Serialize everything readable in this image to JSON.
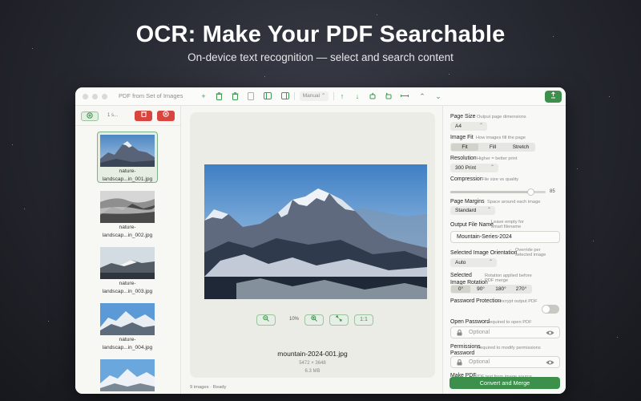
{
  "hero": {
    "title": "OCR: Make Your PDF Searchable",
    "subtitle": "On-device text recognition — select and search content"
  },
  "window": {
    "title": "PDF from Set of Images",
    "toolbar": {
      "mode_select": "Manual",
      "icons": [
        "add-icon",
        "trash-icon",
        "trash-icon",
        "document-icon",
        "sidebar-left-icon",
        "sidebar-right-icon",
        "arrow-up-icon",
        "arrow-down-icon",
        "rotate-left-icon",
        "rotate-right-icon",
        "dash-icon",
        "chevron-up-icon",
        "chevron-down-icon",
        "export-icon"
      ]
    }
  },
  "sidebar": {
    "count": "1 s...",
    "items": [
      {
        "label_line1": "nature-",
        "label_line2": "landscap...in_001.jpg",
        "selected": true
      },
      {
        "label_line1": "nature-",
        "label_line2": "landscap...in_002.jpg",
        "selected": false
      },
      {
        "label_line1": "nature-",
        "label_line2": "landscap...in_003.jpg",
        "selected": false
      },
      {
        "label_line1": "nature-",
        "label_line2": "landscap...in_004.jpg",
        "selected": false
      },
      {
        "label_line1": "",
        "label_line2": "",
        "selected": false
      }
    ],
    "status": "9 images · Ready"
  },
  "canvas": {
    "zoom": "10%",
    "fit_label": "1:1",
    "file_name": "mountain-2024-001.jpg",
    "dimensions": "5472 × 3648",
    "size": "6.3 MB"
  },
  "settings": {
    "page_size": {
      "label": "Page Size",
      "hint": "Output page dimensions",
      "value": "A4"
    },
    "image_fit": {
      "label": "Image Fit",
      "hint": "How images fill the page",
      "options": [
        "Fit",
        "Fill",
        "Stretch"
      ],
      "selected": "Fit"
    },
    "resolution": {
      "label": "Resolution",
      "hint": "Higher = better print",
      "value": "300 Print"
    },
    "compression": {
      "label": "Compression",
      "hint": "File size vs quality",
      "value": 85,
      "display": "85"
    },
    "page_margins": {
      "label": "Page Margins",
      "hint": "Space around each image",
      "value": "Standard"
    },
    "output_name": {
      "label": "Output File Name",
      "hint_line1": "Leave empty for",
      "hint_line2": "smart filename",
      "value": "Mountain-Series-2024"
    },
    "orientation": {
      "label": "Selected Image Orientation",
      "hint_line1": "Override per",
      "hint_line2": "selected image",
      "value": "Auto"
    },
    "rotation": {
      "label_line1": "Selected",
      "label_line2": "Image Rotation",
      "hint_line1": "Rotation applied before",
      "hint_line2": "PDF merge",
      "options": [
        "0°",
        "90°",
        "180°",
        "270°"
      ],
      "selected": "0°"
    },
    "password_protection": {
      "label": "Password Protection",
      "hint": "Encrypt output PDF",
      "enabled": false
    },
    "open_password": {
      "label": "Open Password",
      "hint": "Required to open PDF",
      "placeholder": "Optional"
    },
    "permissions_password": {
      "label_line1": "Permissions",
      "label_line2": "Password",
      "hint": "Required to modify permissions",
      "placeholder": "Optional"
    },
    "make_pdf": {
      "label": "Make PDF",
      "hint": "PDF text from image source"
    },
    "merge_button": "Convert and Merge"
  },
  "colors": {
    "accent": "#3d8f4c",
    "danger": "#d9443e",
    "background": "#25272f"
  }
}
